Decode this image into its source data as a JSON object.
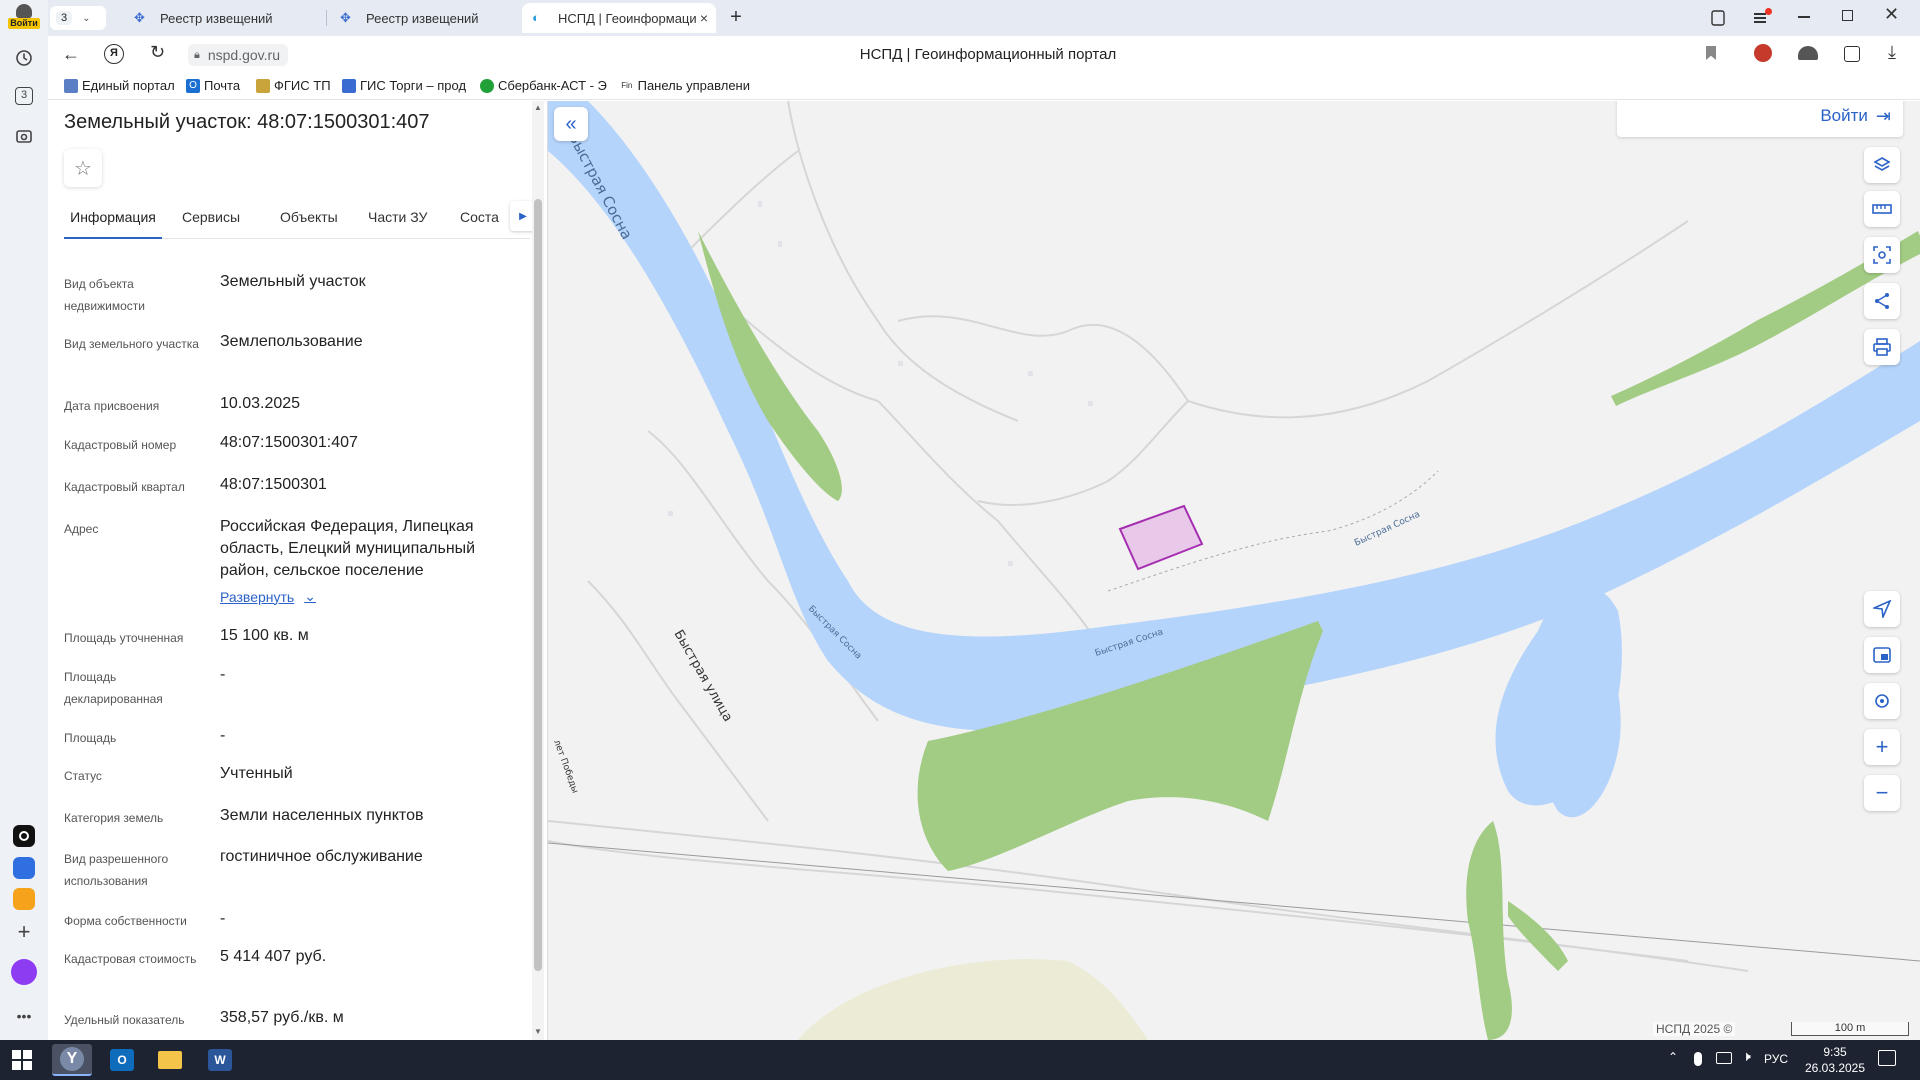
{
  "browser": {
    "profile_label": "Войти",
    "tab_count": "3",
    "tabs": [
      {
        "label": "Реестр извещений"
      },
      {
        "label": "Реестр извещений"
      },
      {
        "label": "НСПД | Геоинформаци"
      }
    ],
    "url": "nspd.gov.ru",
    "page_title": "НСПД | Геоинформационный портал",
    "bookmarks": [
      {
        "label": "Единый портал"
      },
      {
        "label": "Почта"
      },
      {
        "label": "ФГИС ТП"
      },
      {
        "label": "ГИС Торги – прод"
      },
      {
        "label": "Сбербанк-АСТ - Э"
      },
      {
        "label": "Панель управлени"
      }
    ],
    "rail_badge": "3"
  },
  "panel": {
    "title": "Земельный участок: 48:07:1500301:407",
    "tabs": [
      {
        "label": "Информация",
        "active": true
      },
      {
        "label": "Сервисы"
      },
      {
        "label": "Объекты"
      },
      {
        "label": "Части ЗУ"
      },
      {
        "label": "Соста"
      }
    ],
    "properties": [
      {
        "label": "Вид объекта недвижимости",
        "value": "Земельный участок"
      },
      {
        "label": "Вид земельного участка",
        "value": "Землепользование"
      },
      {
        "label": "Дата присвоения",
        "value": "10.03.2025"
      },
      {
        "label": "Кадастровый номер",
        "value": "48:07:1500301:407"
      },
      {
        "label": "Кадастровый квартал",
        "value": "48:07:1500301"
      },
      {
        "label": "Адрес",
        "value": "Российская Федерация, Липецкая область, Елецкий муниципальный район, сельское поселение"
      },
      {
        "label": "Площадь уточненная",
        "value": "15 100 кв. м"
      },
      {
        "label": "Площадь декларированная",
        "value": "-"
      },
      {
        "label": "Площадь",
        "value": "-"
      },
      {
        "label": "Статус",
        "value": "Учтенный"
      },
      {
        "label": "Категория земель",
        "value": "Земли населенных пунктов"
      },
      {
        "label": "Вид разрешенного использования",
        "value": "гостиничное обслуживание"
      },
      {
        "label": "Форма собственности",
        "value": "-"
      },
      {
        "label": "Кадастровая стоимость",
        "value": "5 414 407 руб."
      },
      {
        "label": "Удельный показатель",
        "value": "358,57 руб./кв. м"
      }
    ],
    "expand_label": "Развернуть"
  },
  "map": {
    "login_label": "Войти",
    "labels": {
      "river_top": "Быстрая Сосна",
      "river_mid1": "Быстрая Сосна",
      "river_mid2": "Быстрая Сосна",
      "river_right": "Быстрая Сосна",
      "street": "Быстрая улица",
      "street2": "лет Победы"
    },
    "copyright": "НСПД 2025 ©",
    "scale": "100 m"
  },
  "taskbar": {
    "lang": "РУС",
    "time": "9:35",
    "date": "26.03.2025"
  },
  "colors": {
    "river": "#b5d4fb",
    "greenery": "#a2cb83",
    "parcel_fill": "#e9c9ea",
    "parcel_stroke": "#a52fb0",
    "accent": "#2b63c8"
  }
}
